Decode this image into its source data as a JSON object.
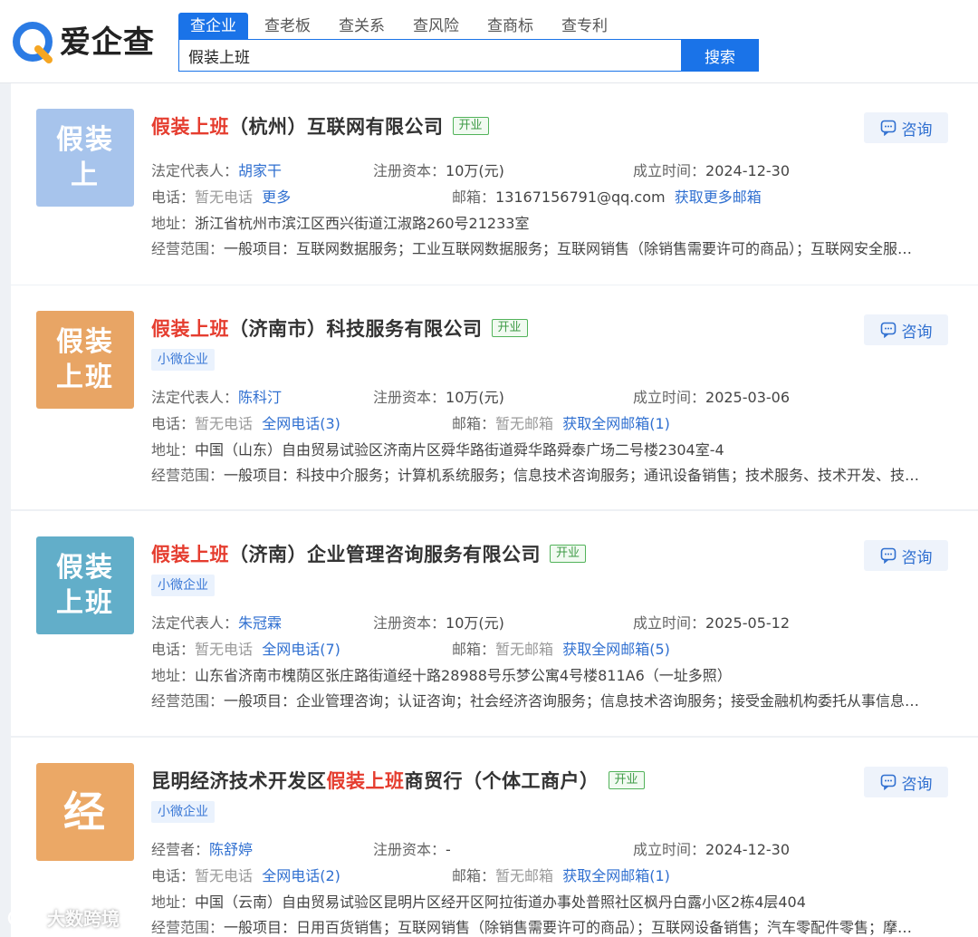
{
  "app": {
    "name": "爱企查"
  },
  "tabs": [
    "查企业",
    "查老板",
    "查关系",
    "查风险",
    "查商标",
    "查专利"
  ],
  "search": {
    "value": "假装上班",
    "button": "搜索"
  },
  "consult_label": "咨询",
  "labels": {
    "legal_rep": "法定代表人：",
    "operator": "经营者：",
    "capital": "注册资本：",
    "founded": "成立时间：",
    "phone": "电话：",
    "email": "邮箱：",
    "address": "地址：",
    "scope": "经营范围："
  },
  "companies": [
    {
      "avatar_lines": [
        "假装",
        "上"
      ],
      "avatar_color": "#a7c4ec",
      "title_pre": "",
      "title_hl": "假装上班",
      "title_post": "（杭州）互联网有限公司",
      "status": "开业",
      "tag": "",
      "rep": "胡家干",
      "capital": "10万(元)",
      "founded": "2024-12-30",
      "phone": "暂无电话",
      "phone_link": "更多",
      "email": "13167156791@qq.com",
      "email_link": "获取更多邮箱",
      "address": "浙江省杭州市滨江区西兴街道江淑路260号21233室",
      "scope": "一般项目：互联网数据服务；工业互联网数据服务；互联网销售（除销售需要许可的商品）；互联网安全服…"
    },
    {
      "avatar_lines": [
        "假装",
        "上班"
      ],
      "avatar_color": "#e8a565",
      "title_pre": "",
      "title_hl": "假装上班",
      "title_post": "（济南市）科技服务有限公司",
      "status": "开业",
      "tag": "小微企业",
      "rep": "陈科汀",
      "capital": "10万(元)",
      "founded": "2025-03-06",
      "phone": "暂无电话",
      "phone_link": "全网电话(3)",
      "email": "暂无邮箱",
      "email_link": "获取全网邮箱(1)",
      "address": "中国（山东）自由贸易试验区济南片区舜华路街道舜华路舜泰广场二号楼2304室-4",
      "scope": "一般项目：科技中介服务；计算机系统服务；信息技术咨询服务；通讯设备销售；技术服务、技术开发、技…"
    },
    {
      "avatar_lines": [
        "假装",
        "上班"
      ],
      "avatar_color": "#62aec9",
      "title_pre": "",
      "title_hl": "假装上班",
      "title_post": "（济南）企业管理咨询服务有限公司",
      "status": "开业",
      "tag": "小微企业",
      "rep": "朱冠霖",
      "capital": "10万(元)",
      "founded": "2025-05-12",
      "phone": "暂无电话",
      "phone_link": "全网电话(7)",
      "email": "暂无邮箱",
      "email_link": "获取全网邮箱(5)",
      "address": "山东省济南市槐荫区张庄路街道经十路28988号乐梦公寓4号楼811A6（一址多照）",
      "scope": "一般项目：企业管理咨询；认证咨询；社会经济咨询服务；信息技术咨询服务；接受金融机构委托从事信息…"
    },
    {
      "avatar_lines": [
        "经"
      ],
      "avatar_color": "#eba866",
      "title_pre": "昆明经济技术开发区",
      "title_hl": "假装上班",
      "title_post": "商贸行（个体工商户）",
      "status": "开业",
      "tag": "小微企业",
      "rep": "陈舒婷",
      "capital": "-",
      "founded": "2024-12-30",
      "phone": "暂无电话",
      "phone_link": "全网电话(2)",
      "email": "暂无邮箱",
      "email_link": "获取全网邮箱(1)",
      "address": "中国（云南）自由贸易试验区昆明片区经开区阿拉街道办事处普照社区枫丹白露小区2栋4层404",
      "scope": "一般项目：日用百货销售；互联网销售（除销售需要许可的商品）；互联网设备销售；汽车零配件零售；摩…"
    }
  ],
  "watermark": "大数跨境"
}
